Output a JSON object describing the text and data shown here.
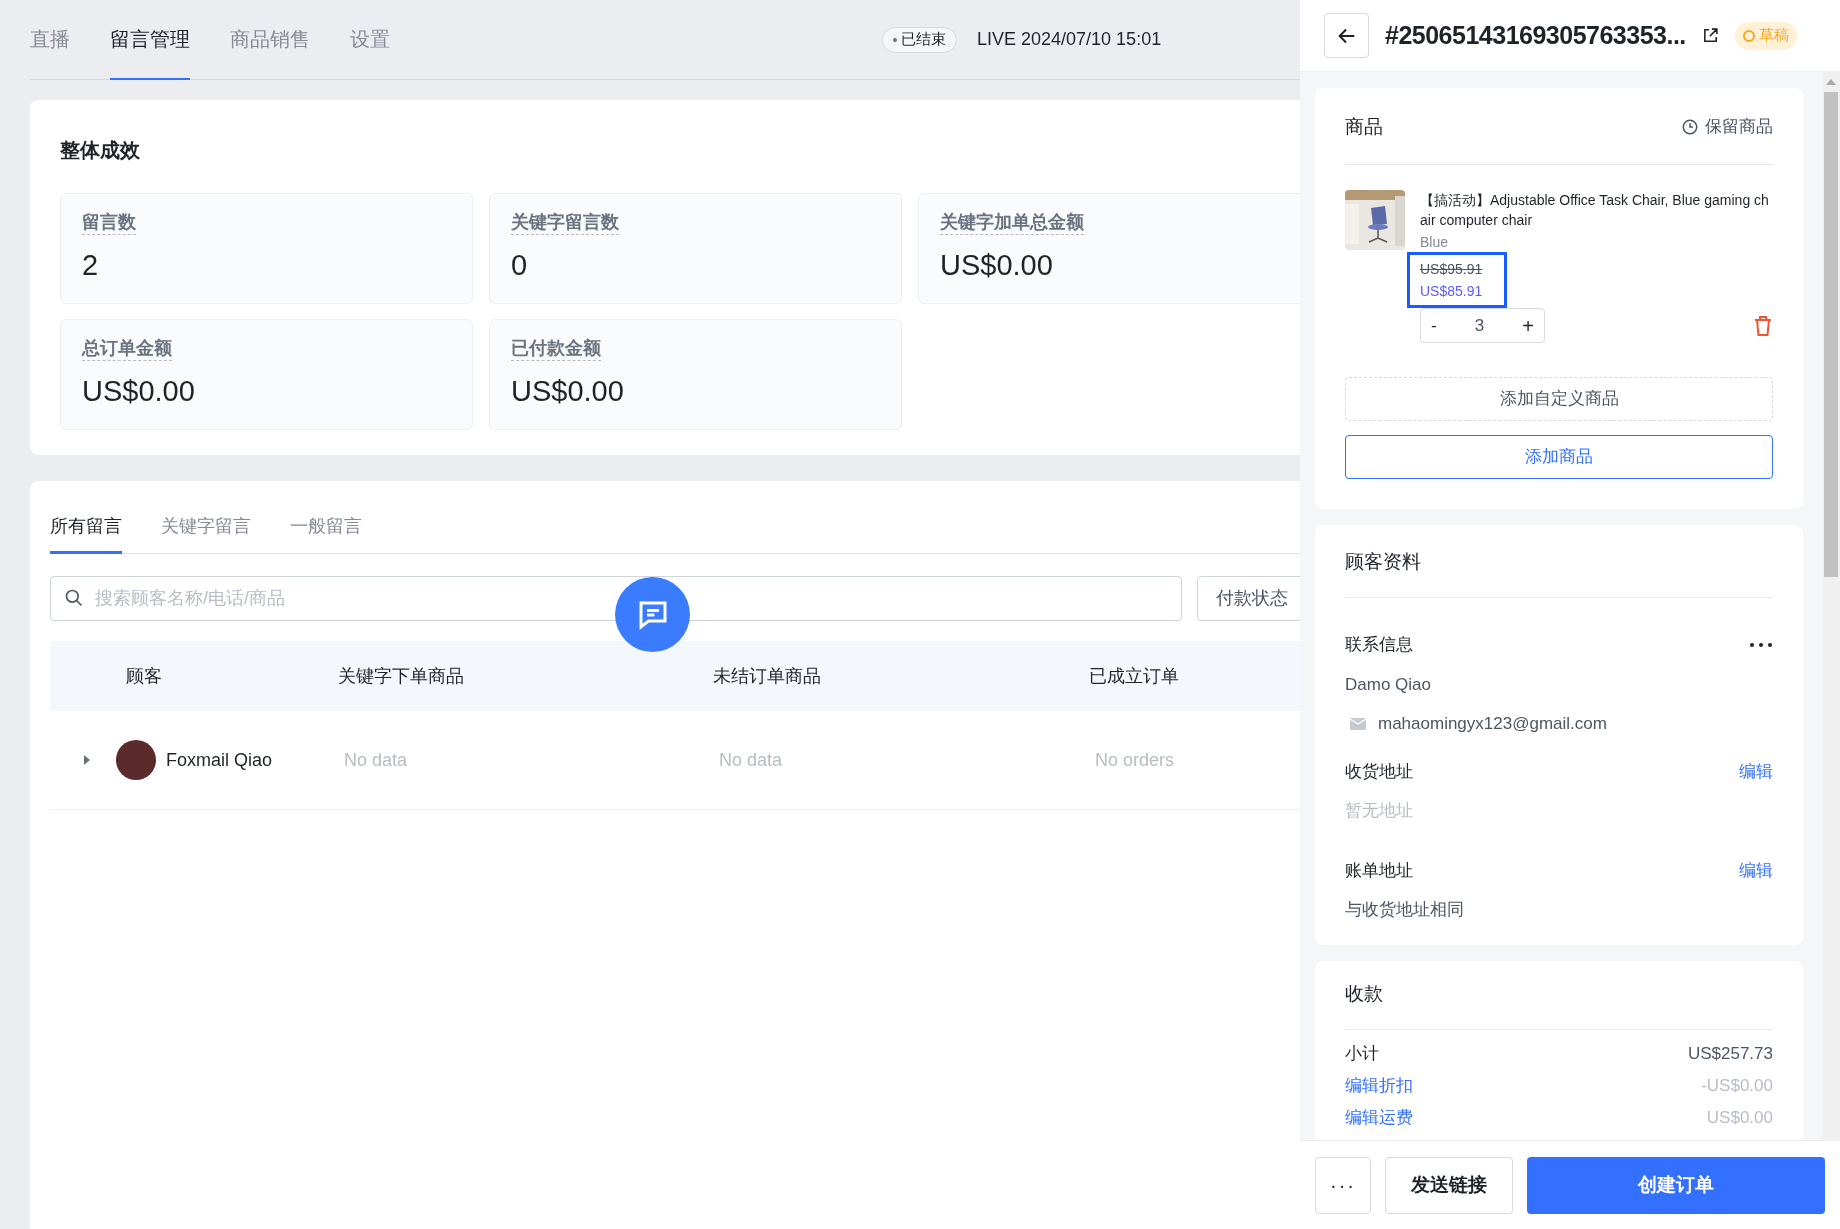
{
  "nav_tabs": [
    {
      "label": "直播",
      "selected": false
    },
    {
      "label": "留言管理",
      "selected": true
    },
    {
      "label": "商品销售",
      "selected": false
    },
    {
      "label": "设置",
      "selected": false
    }
  ],
  "live_status": {
    "badge": "已结束",
    "time": "LIVE 2024/07/10 15:01"
  },
  "overview": {
    "title": "整体成效",
    "stats": [
      {
        "label": "留言数",
        "value": "2"
      },
      {
        "label": "关键字留言数",
        "value": "0"
      },
      {
        "label": "关键字加单总金额",
        "value": "US$0.00"
      },
      {
        "label": "总订单金额",
        "value": "US$0.00"
      },
      {
        "label": "已付款金额",
        "value": "US$0.00"
      }
    ]
  },
  "comment_tabs": [
    {
      "label": "所有留言",
      "selected": true
    },
    {
      "label": "关键字留言",
      "selected": false
    },
    {
      "label": "一般留言",
      "selected": false
    }
  ],
  "search": {
    "placeholder": "搜索顾客名称/电话/商品"
  },
  "filter": {
    "label": "付款状态"
  },
  "table": {
    "columns": [
      "顾客",
      "关键字下单商品",
      "未结订单商品",
      "已成立订单"
    ],
    "rows": [
      {
        "customer": "Foxmail Qiao",
        "keyword_items": "No data",
        "open_items": "No data",
        "orders": "No orders",
        "expanded": false
      }
    ]
  },
  "order_panel": {
    "title": "#25065143169305763353...",
    "status": "草稿",
    "products": {
      "title": "商品",
      "reserve": "保留商品",
      "items": [
        {
          "name": "【搞活动】Adjustable Office Task Chair, Blue gaming chair computer chair",
          "variant": "Blue",
          "original_price": "US$95.91",
          "price": "US$85.91",
          "quantity": "3",
          "minus": "-",
          "plus": "+"
        }
      ],
      "add_custom": "添加自定义商品",
      "add": "添加商品"
    },
    "customer": {
      "title": "顾客资料",
      "contact_label": "联系信息",
      "name": "Damo Qiao",
      "email": "mahaomingyx123@gmail.com",
      "shipping_label": "收货地址",
      "shipping_edit": "编辑",
      "shipping_value": "暂无地址",
      "billing_label": "账单地址",
      "billing_edit": "编辑",
      "billing_value": "与收货地址相同"
    },
    "payment": {
      "title": "收款",
      "rows": [
        {
          "label": "小计",
          "value": "US$257.73",
          "kind": "plain"
        },
        {
          "label": "编辑折扣",
          "value": "-US$0.00",
          "kind": "link"
        },
        {
          "label": "编辑运费",
          "value": "US$0.00",
          "kind": "link"
        }
      ]
    },
    "footer": {
      "more": "···",
      "send": "发送链接",
      "create": "创建订单"
    }
  }
}
